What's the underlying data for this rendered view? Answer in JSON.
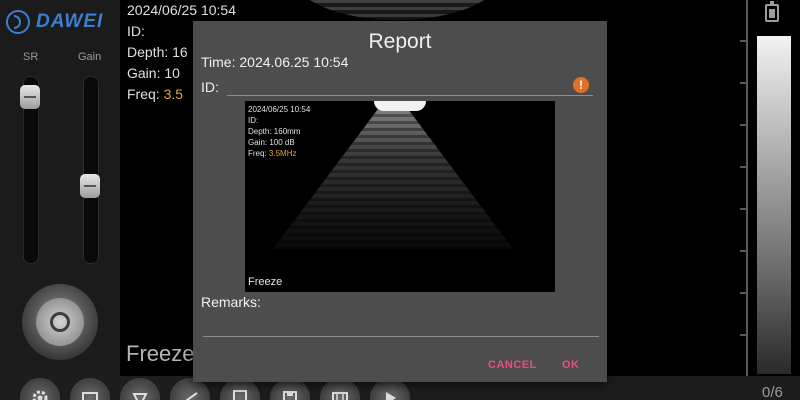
{
  "app": {
    "brand": "DAWEI"
  },
  "left_panel": {
    "sliders": [
      {
        "label": "SR",
        "level": 0.05
      },
      {
        "label": "Gain",
        "level": 0.6
      }
    ]
  },
  "background": {
    "date_time": "2024/06/25 10:54",
    "id_line": "ID:",
    "depth_line": "Depth: 16",
    "gain_line": "Gain: 10",
    "freq_label": "Freq: ",
    "freq_value": "3.5",
    "mode_label": "Freeze"
  },
  "dialog": {
    "title": "Report",
    "time_line": "Time: 2024.06.25 10:54",
    "id_label": "ID:",
    "id_value": "",
    "thumbnail": {
      "date_time": "2024/06/25 10:54",
      "id_line": "ID:",
      "depth_line": "Depth: 160mm",
      "gain_line": "Gain: 100 dB",
      "freq_label": "Freq: ",
      "freq_value": "3.5MHz",
      "mode_label": "Freeze"
    },
    "remarks_label": "Remarks:",
    "remarks_value": "",
    "cancel_label": "CANCEL",
    "ok_label": "OK"
  },
  "toolbar": {
    "icons": [
      "settings-icon",
      "image-icon",
      "transducer-icon",
      "measure-icon",
      "report-icon",
      "save-icon",
      "film-icon",
      "play-icon"
    ],
    "page_indicator": "0/6"
  },
  "colors": {
    "brand": "#3b7fcf",
    "accent_button": "#ee4b86",
    "freq_text": "#e8a33a",
    "warning": "#e56f22"
  }
}
